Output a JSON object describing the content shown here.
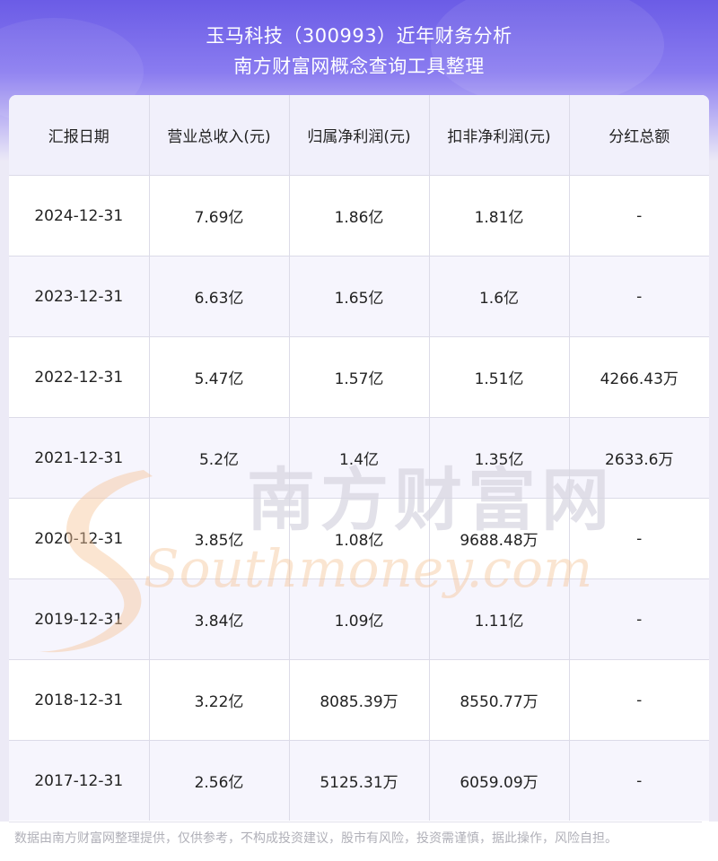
{
  "title_line1": "玉马科技（300993）近年财务分析",
  "title_line2": "南方财富网概念查询工具整理",
  "table": {
    "headers": [
      "汇报日期",
      "营业总收入(元)",
      "归属净利润(元)",
      "扣非净利润(元)",
      "分红总额"
    ],
    "rows": [
      [
        "2024-12-31",
        "7.69亿",
        "1.86亿",
        "1.81亿",
        "-"
      ],
      [
        "2023-12-31",
        "6.63亿",
        "1.65亿",
        "1.6亿",
        "-"
      ],
      [
        "2022-12-31",
        "5.47亿",
        "1.57亿",
        "1.51亿",
        "4266.43万"
      ],
      [
        "2021-12-31",
        "5.2亿",
        "1.4亿",
        "1.35亿",
        "2633.6万"
      ],
      [
        "2020-12-31",
        "3.85亿",
        "1.08亿",
        "9688.48万",
        "-"
      ],
      [
        "2019-12-31",
        "3.84亿",
        "1.09亿",
        "1.11亿",
        "-"
      ],
      [
        "2018-12-31",
        "3.22亿",
        "8085.39万",
        "8550.77万",
        "-"
      ],
      [
        "2017-12-31",
        "2.56亿",
        "5125.31万",
        "6059.09万",
        "-"
      ]
    ]
  },
  "watermark": {
    "cn": "南方财富网",
    "en": "Southmoney.com"
  },
  "footer": "数据由南方财富网整理提供，仅供参考，不构成投资建议，股市有风险，投资需谨慎，据此操作，风险自担。",
  "colors": {
    "header_top": "#6b5ce6",
    "row_alt": "#f6f5fd",
    "header_row": "#f1f0fb",
    "watermark_orange": "#f6c69a"
  }
}
